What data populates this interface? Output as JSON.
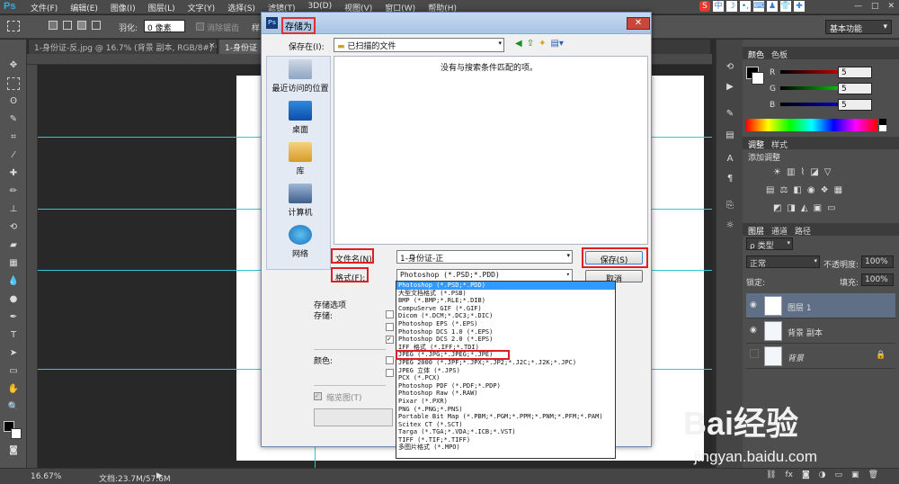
{
  "app": {
    "logo": "Ps"
  },
  "menu": [
    "文件(F)",
    "编辑(E)",
    "图像(I)",
    "图层(L)",
    "文字(Y)",
    "选择(S)",
    "滤镜(T)",
    "3D(D)",
    "视图(V)",
    "窗口(W)",
    "帮助(H)"
  ],
  "tray_icons": [
    "sogou-s",
    "中",
    "moon",
    "comma",
    "keyboard",
    "person",
    "shirt",
    "wrench"
  ],
  "tray_labels": [
    "S",
    "中",
    "☽",
    "•,",
    "⌨",
    "♟",
    "👕",
    "✚"
  ],
  "window_controls": [
    "—",
    "□",
    "✕"
  ],
  "options": {
    "feather_label": "羽化:",
    "feather_value": "0 像素",
    "antialias_label": "消除锯齿",
    "style_label": "样",
    "workspace": "基本功能"
  },
  "tabs": [
    {
      "label": "1-身份证-反.jpg @ 16.7% (背景 副本, RGB/8#) *",
      "close": "×"
    },
    {
      "label": "1-身份证",
      "close": ""
    }
  ],
  "status": {
    "zoom": "16.67%",
    "doc": "文档:23.7M/57.6M"
  },
  "dialog": {
    "title": "存储为",
    "save_in_label": "保存在(I):",
    "save_in_value": "已扫描的文件",
    "empty_message": "没有与搜索条件匹配的项。",
    "places": [
      {
        "label": "最近访问的位置",
        "icon": "recent-places-icon"
      },
      {
        "label": "桌面",
        "icon": "desktop-icon"
      },
      {
        "label": "库",
        "icon": "library-icon"
      },
      {
        "label": "计算机",
        "icon": "computer-icon"
      },
      {
        "label": "网络",
        "icon": "network-icon"
      }
    ],
    "filename_label": "文件名(N):",
    "filename_value": "1-身份证-正",
    "format_label": "格式(F):",
    "format_value": "Photoshop (*.PSD;*.PDD)",
    "save_button": "保存(S)",
    "cancel_button": "取消",
    "save_options_label": "存储选项",
    "storage_label": "存储:",
    "color_label": "颜色:",
    "thumbnail_label": "缩览图(T)",
    "format_options": [
      "Photoshop (*.PSD;*.PDD)",
      "大型文档格式 (*.PSB)",
      "BMP (*.BMP;*.RLE;*.DIB)",
      "CompuServe GIF (*.GIF)",
      "Dicom (*.DCM;*.DC3;*.DIC)",
      "Photoshop EPS (*.EPS)",
      "Photoshop DCS 1.0 (*.EPS)",
      "Photoshop DCS 2.0 (*.EPS)",
      "IFF 格式 (*.IFF;*.TDI)",
      "JPEG (*.JPG;*.JPEG;*.JPE)",
      "JPEG 2000 (*.JPF;*.JPX;*.JP2;*.J2C;*.J2K;*.JPC)",
      "JPEG 立体 (*.JPS)",
      "PCX (*.PCX)",
      "Photoshop PDF (*.PDF;*.PDP)",
      "Photoshop Raw (*.RAW)",
      "Pixar (*.PXR)",
      "PNG (*.PNG;*.PNS)",
      "Portable Bit Map (*.PBM;*.PGM;*.PPM;*.PNM;*.PFM;*.PAM)",
      "Scitex CT (*.SCT)",
      "Targa (*.TGA;*.VDA;*.ICB;*.VST)",
      "TIFF (*.TIF;*.TIFF)",
      "多图片格式 (*.MPO)"
    ]
  },
  "color_panel": {
    "tabs": [
      "颜色",
      "色板"
    ],
    "channels": [
      {
        "label": "R",
        "value": "5"
      },
      {
        "label": "G",
        "value": "5"
      },
      {
        "label": "B",
        "value": "5"
      }
    ]
  },
  "adjust_panel": {
    "tabs": [
      "调整",
      "样式"
    ],
    "title": "添加调整"
  },
  "layers_panel": {
    "tabs": [
      "图层",
      "通道",
      "路径"
    ],
    "kind_filter": "ρ 类型",
    "blend_mode": "正常",
    "opacity_label": "不透明度:",
    "opacity_value": "100%",
    "lock_label": "锁定:",
    "fill_label": "填充:",
    "fill_value": "100%",
    "layers": [
      {
        "name": "图层 1",
        "visible": true,
        "selected": true
      },
      {
        "name": "背景 副本",
        "visible": true,
        "selected": false
      },
      {
        "name": "背景",
        "visible": false,
        "selected": false
      }
    ],
    "footer_icons": [
      "link-icon",
      "fx-icon",
      "mask-icon",
      "adjustment-icon",
      "folder-icon",
      "new-layer-icon",
      "trash-icon"
    ]
  },
  "watermark": {
    "brand": "Bai经验",
    "url": "jingyan.baidu.com"
  }
}
